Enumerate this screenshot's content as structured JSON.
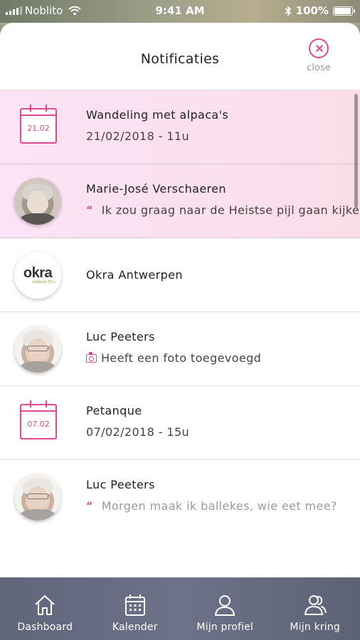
{
  "status_bar": {
    "carrier": "Noblito",
    "time": "9:41 AM",
    "battery": "100%",
    "battery_level": 1.0
  },
  "sheet": {
    "title": "Notificaties",
    "close_label": "close"
  },
  "notifications": [
    {
      "kind": "event",
      "icon": "calendar-icon",
      "date_badge": "21.02",
      "title": "Wandeling met alpaca's",
      "subtitle": "21/02/2018 - 11u",
      "highlighted": true
    },
    {
      "kind": "message",
      "icon": "quote-icon",
      "title": "Marie-José Verschaeren",
      "subtitle": "Ik zou graag naar de Heistse pijl gaan kijken",
      "highlighted": true
    },
    {
      "kind": "group",
      "title": "Okra Antwerpen",
      "logo_text": "okra",
      "logo_tag": "trefpunt 55+",
      "highlighted": false
    },
    {
      "kind": "photo",
      "icon": "camera-icon",
      "title": "Luc Peeters",
      "subtitle": "Heeft een foto toegevoegd",
      "highlighted": false
    },
    {
      "kind": "event",
      "icon": "calendar-icon",
      "date_badge": "07.02",
      "title": "Petanque",
      "subtitle": "07/02/2018 - 15u",
      "highlighted": false
    },
    {
      "kind": "message",
      "icon": "quote-icon",
      "title": "Luc Peeters",
      "subtitle": "Morgen maak ik ballekes, wie eet mee?",
      "highlighted": false
    }
  ],
  "tabbar": {
    "tabs": [
      {
        "label": "Dashboard",
        "icon": "home-icon"
      },
      {
        "label": "Kalender",
        "icon": "calendar-icon"
      },
      {
        "label": "Mijn profiel",
        "icon": "profile-icon"
      },
      {
        "label": "Mijn kring",
        "icon": "group-icon"
      }
    ]
  },
  "colors": {
    "accent": "#e0488f",
    "highlight_bg": "#fbe2f2",
    "tabbar_bg": "#676c82"
  }
}
